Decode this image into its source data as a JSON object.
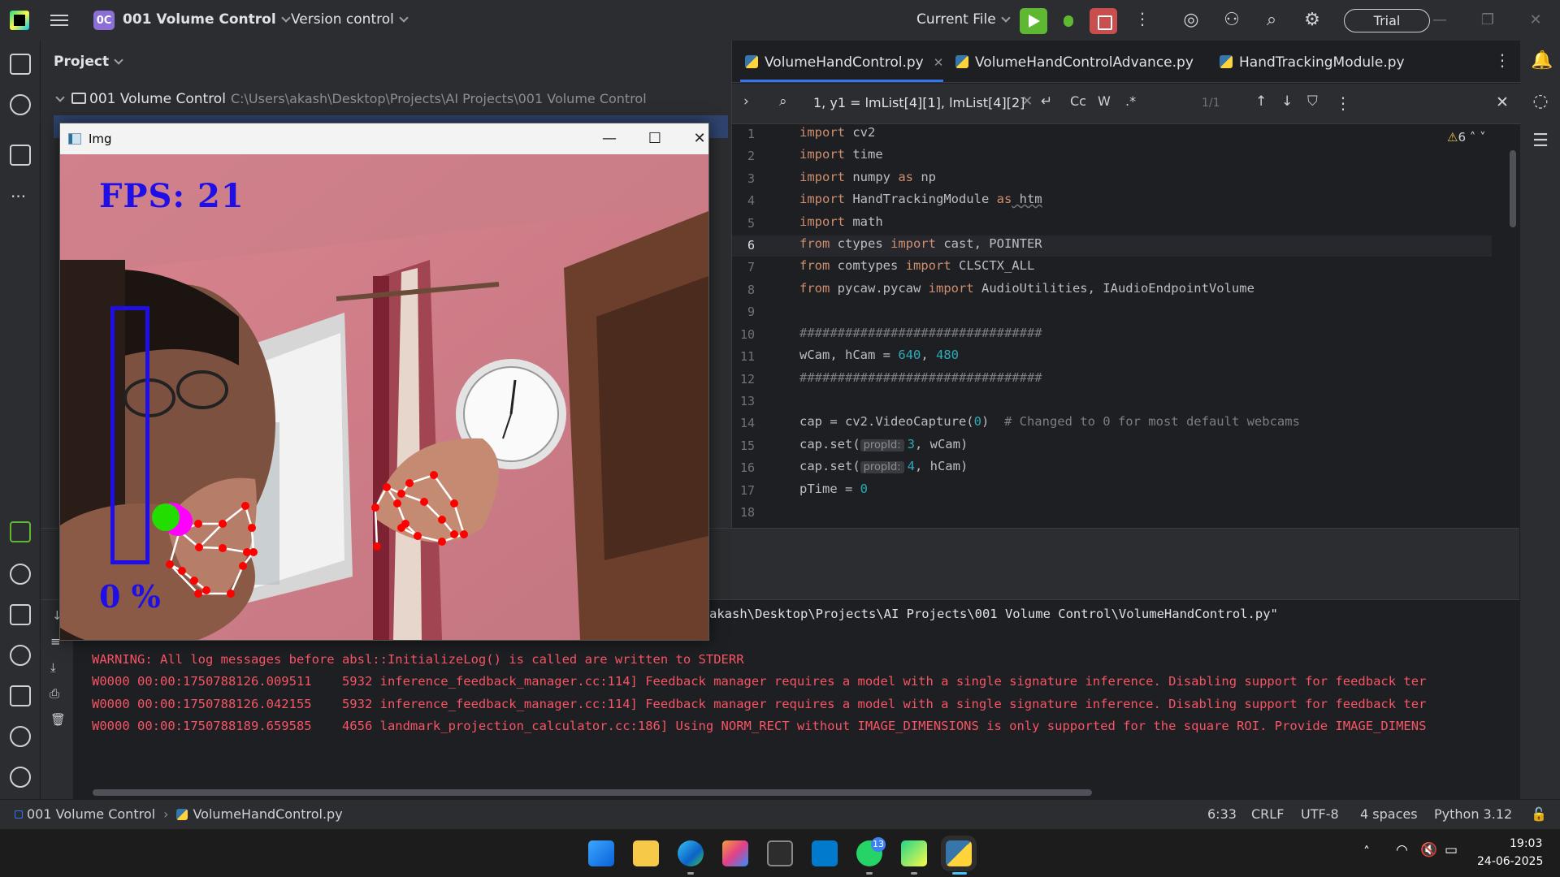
{
  "titlebar": {
    "project_badge": "0C",
    "project_name": "001 Volume Control",
    "vcs": "Version control",
    "run_config": "Current File",
    "trial": "Trial"
  },
  "project_panel": {
    "header": "Project",
    "root_name": "001 Volume Control",
    "root_path": "C:\\Users\\akash\\Desktop\\Projects\\AI Projects\\001 Volume Control"
  },
  "editor": {
    "tabs": [
      {
        "label": "VolumeHandControl.py"
      },
      {
        "label": "VolumeHandControlAdvance.py"
      },
      {
        "label": "HandTrackingModule.py"
      }
    ],
    "find_query": "1, y1 = lmList[4][1], lmList[4][2]",
    "find_count": "1/1",
    "find_opts": {
      "case": "Cc",
      "word": "W",
      "regex": ".*"
    },
    "warnings": "6",
    "line_numbers": [
      "1",
      "2",
      "3",
      "4",
      "5",
      "6",
      "7",
      "8",
      "9",
      "10",
      "11",
      "12",
      "13",
      "14",
      "15",
      "16",
      "17",
      "18"
    ],
    "code": {
      "l1a": "import",
      "l1b": " cv2",
      "l2a": "import",
      "l2b": " time",
      "l3a": "import",
      "l3b": " numpy ",
      "l3c": "as",
      "l3d": " np",
      "l4a": "import",
      "l4b": " HandTrackingModule ",
      "l4c": "as",
      "l4d": " htm",
      "l5a": "import",
      "l5b": " math",
      "l6a": "from",
      "l6b": " ctypes ",
      "l6c": "import",
      "l6d": " cast, POINTER",
      "l7a": "from",
      "l7b": " comtypes ",
      "l7c": "import",
      "l7d": " CLSCTX_ALL",
      "l8a": "from",
      "l8b": " pycaw.pycaw ",
      "l8c": "import",
      "l8d": " AudioUtilities, IAudioEndpointVolume",
      "l10": "################################",
      "l11a": "wCam, hCam = ",
      "l11b": "640",
      "l11c": ", ",
      "l11d": "480",
      "l12": "################################",
      "l14a": "cap = cv2.VideoCapture(",
      "l14b": "0",
      "l14c": ")  ",
      "l14d": "# Changed to 0 for most default webcams",
      "l15a": "cap.set(",
      "l15hint": "propId:",
      "l15b": "3",
      "l15c": ", wCam)",
      "l16a": "cap.set(",
      "l16hint": "propId:",
      "l16b": "4",
      "l16c": ", hCam)",
      "l17a": "pTime = ",
      "l17b": "0"
    }
  },
  "console": {
    "cmd": "akash\\Desktop\\Projects\\AI Projects\\001 Volume Control\\VolumeHandControl.py\"",
    "lines": [
      "WARNING: All log messages before absl::InitializeLog() is called are written to STDERR",
      "W0000 00:00:1750788126.009511    5932 inference_feedback_manager.cc:114] Feedback manager requires a model with a single signature inference. Disabling support for feedback ter",
      "W0000 00:00:1750788126.042155    5932 inference_feedback_manager.cc:114] Feedback manager requires a model with a single signature inference. Disabling support for feedback ter",
      "W0000 00:00:1750788189.659585    4656 landmark_projection_calculator.cc:186] Using NORM_RECT without IMAGE_DIMENSIONS is only supported for the square ROI. Provide IMAGE_DIMENS"
    ]
  },
  "statusbar": {
    "crumb_project": "001 Volume Control",
    "crumb_file": "VolumeHandControl.py",
    "position": "6:33",
    "line_sep": "CRLF",
    "encoding": "UTF-8",
    "indent": "4 spaces",
    "interpreter": "Python 3.12"
  },
  "taskbar": {
    "whatsapp_badge": "13",
    "time": "19:03",
    "date": "24-06-2025"
  },
  "img_window": {
    "title": "Img",
    "fps": "FPS: 21",
    "volume": "0 %"
  },
  "colors": {
    "accent": "#3574f0",
    "run_green": "#5fb832",
    "stop_red": "#c94f4f",
    "error_text": "#f75464",
    "overlay_blue": "#1f0fe6"
  }
}
